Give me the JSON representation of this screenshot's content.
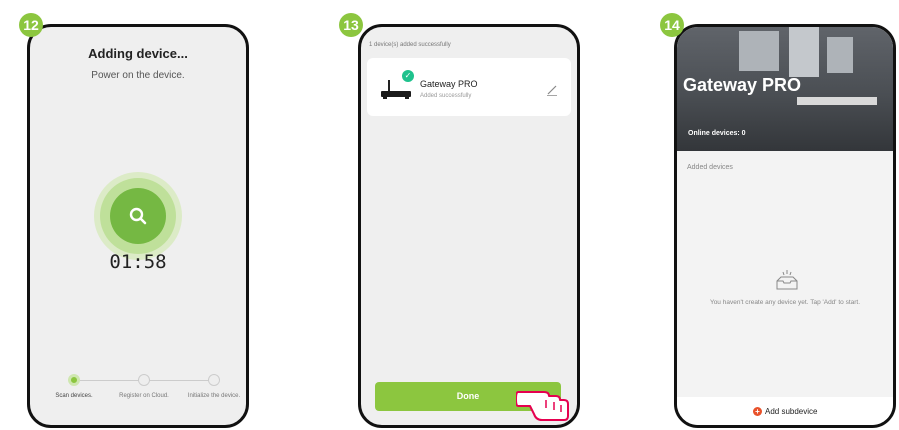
{
  "steps": {
    "s12": {
      "badge": "12",
      "title": "Adding device...",
      "subtitle": "Power on the device.",
      "timer": "01:58",
      "progress_steps": [
        "Scan devices.",
        "Register on Cloud.",
        "Initialize the device."
      ],
      "active_step": 1
    },
    "s13": {
      "badge": "13",
      "status": "1 device(s) added successfully",
      "device_name": "Gateway PRO",
      "device_status": "Added successfully",
      "done_label": "Done"
    },
    "s14": {
      "badge": "14",
      "title": "Gateway PRO",
      "online_devices": "Online devices: 0",
      "section_label": "Added devices",
      "empty_message": "You haven't create any device yet. Tap 'Add' to start.",
      "add_label": "Add subdevice"
    }
  },
  "colors": {
    "brand_green": "#8cc63f",
    "check_teal": "#1fc28d",
    "add_orange": "#e8522b"
  },
  "icons": [
    "search-icon",
    "check-icon",
    "edit-icon",
    "router-icon",
    "pointing-hand-icon",
    "empty-tray-icon",
    "plus-icon"
  ]
}
